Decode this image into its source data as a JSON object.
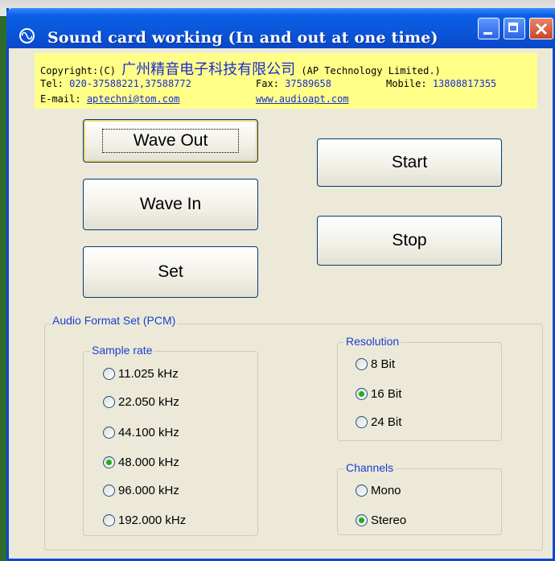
{
  "window": {
    "title": "Sound card working (In and out at one time)"
  },
  "info": {
    "copyright_label": "Copyright:(C)",
    "company_cn": "广州精音电子科技有限公司",
    "company_en": "(AP Technology Limited.)",
    "tel_label": "Tel:",
    "tel_value": "020-37588221,37588772",
    "fax_label": "Fax:",
    "fax_value": "37589658",
    "mobile_label": "Mobile:",
    "mobile_value": "13808817355",
    "email_label": "E-mail:",
    "email_value": "aptechni@tom.com",
    "website": "www.audioapt.com"
  },
  "buttons": {
    "wave_out": "Wave Out",
    "wave_in": "Wave In",
    "set": "Set",
    "start": "Start",
    "stop": "Stop"
  },
  "audio_format": {
    "title": "Audio Format Set (PCM)",
    "sample_rate": {
      "title": "Sample rate",
      "options": [
        "11.025 kHz",
        "22.050 kHz",
        "44.100 kHz",
        "48.000 kHz",
        "96.000 kHz",
        "192.000  kHz"
      ],
      "selected": "48.000 kHz"
    },
    "resolution": {
      "title": "Resolution",
      "options": [
        "8 Bit",
        "16 Bit",
        "24 Bit"
      ],
      "selected": "16 Bit"
    },
    "channels": {
      "title": "Channels",
      "options": [
        "Mono",
        "Stereo"
      ],
      "selected": "Stereo"
    }
  },
  "colors": {
    "title_bar": "#0a57db",
    "info_background": "#ffff88",
    "link_blue": "#1a2cd1",
    "radio_checked": "#22aa22"
  },
  "icons": {
    "app": "sine-wave-icon",
    "minimize": "minimize-icon",
    "maximize": "maximize-icon",
    "close": "close-icon"
  }
}
